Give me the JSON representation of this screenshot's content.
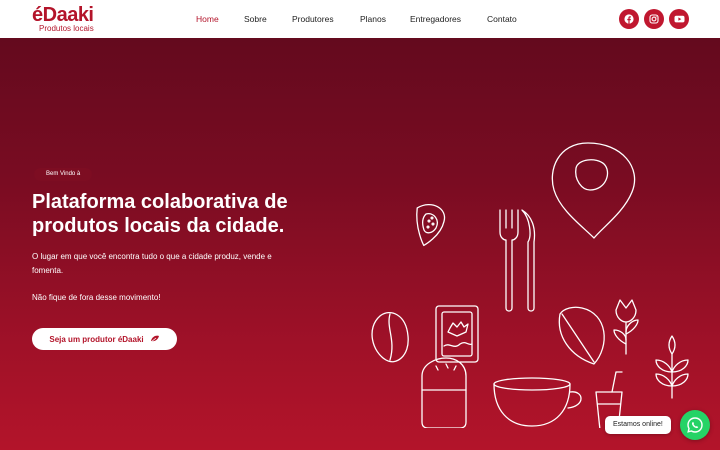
{
  "brand": {
    "name": "éDaaki",
    "tagline": "Produtos locais",
    "color": "#b3142a"
  },
  "nav": {
    "items": [
      {
        "label": "Home",
        "active": true
      },
      {
        "label": "Sobre",
        "active": false
      },
      {
        "label": "Produtores",
        "active": false
      },
      {
        "label": "Planos",
        "active": false
      },
      {
        "label": "Entregadores",
        "active": false
      },
      {
        "label": "Contato",
        "active": false
      }
    ]
  },
  "social": [
    {
      "icon": "facebook-icon"
    },
    {
      "icon": "instagram-icon"
    },
    {
      "icon": "youtube-icon"
    }
  ],
  "hero": {
    "badge": "Bem Vindo à",
    "title": "Plataforma colaborativa de produtos locais da cidade.",
    "text": "O lugar em que você encontra tudo o que a cidade produz, vende e fomenta.",
    "text2": "Não fique de fora desse movimento!",
    "cta_label": "Seja um produtor éDaaki",
    "gradient_top": "#640a1e",
    "gradient_bottom": "#b3142a"
  },
  "chat": {
    "status": "Estamos online!",
    "icon": "whatsapp-icon",
    "color": "#25d366"
  }
}
